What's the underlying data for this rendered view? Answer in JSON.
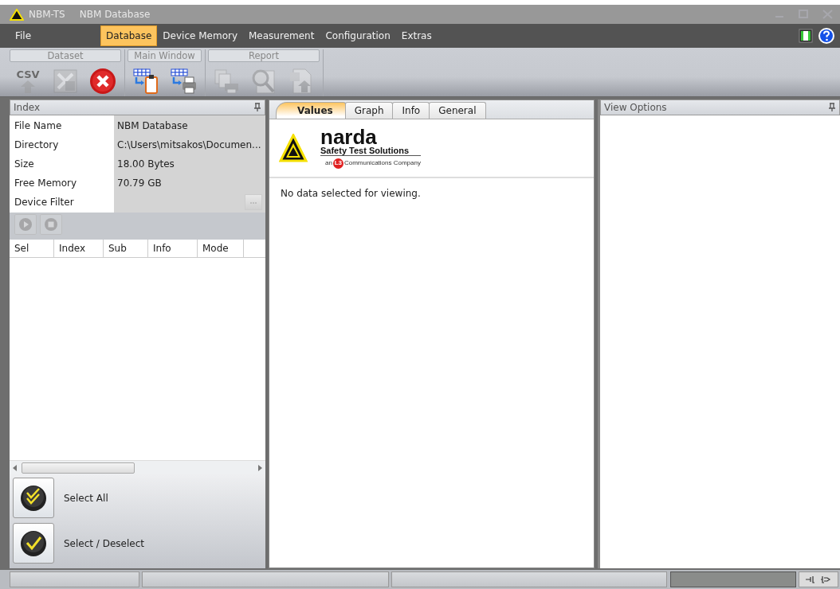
{
  "window": {
    "app": "NBM-TS",
    "title": "NBM Database"
  },
  "menu": [
    {
      "label": "File",
      "selected": false
    },
    {
      "label": "Database",
      "selected": true
    },
    {
      "label": "Device Memory",
      "selected": false
    },
    {
      "label": "Measurement",
      "selected": false
    },
    {
      "label": "Configuration",
      "selected": false
    },
    {
      "label": "Extras",
      "selected": false
    }
  ],
  "toolbar": [
    {
      "label": "Dataset",
      "buttons": [
        {
          "text": "CSV",
          "disabled": true
        },
        {
          "disabled": true
        },
        {
          "disabled": false
        }
      ]
    },
    {
      "label": "Main Window",
      "buttons": [
        {
          "disabled": false
        },
        {
          "disabled": false
        }
      ]
    },
    {
      "label": "Report",
      "buttons": [
        {
          "disabled": true
        },
        {
          "disabled": true
        },
        {
          "disabled": true
        }
      ]
    }
  ],
  "index_panel": {
    "title": "Index",
    "properties": [
      {
        "label": "File Name",
        "value": "NBM Database"
      },
      {
        "label": "Directory",
        "value": "C:\\Users\\mitsakos\\Documen..."
      },
      {
        "label": "Size",
        "value": "18.00 Bytes"
      },
      {
        "label": "Free Memory",
        "value": "70.79 GB"
      },
      {
        "label": "Device Filter"
      }
    ],
    "player_buttons": [
      {
        "disabled": true
      },
      {
        "disabled": true
      }
    ],
    "columns": [
      "Sel",
      "Index",
      "Sub",
      "Info",
      "Mode"
    ],
    "actions": [
      "Select All",
      "Select / Deselect"
    ]
  },
  "center": {
    "tabs": [
      {
        "label": "Values",
        "selected": true
      },
      {
        "label": "Graph",
        "selected": false
      },
      {
        "label": "Info",
        "selected": false
      },
      {
        "label": "General",
        "selected": false
      }
    ],
    "logo": {
      "name": "narda",
      "tagline": "Safety Test Solutions",
      "prefix": "an",
      "badge": "L3",
      "suffix": "Communications Company"
    },
    "message": "No data selected for viewing."
  },
  "view_options": {
    "title": "View Options"
  }
}
